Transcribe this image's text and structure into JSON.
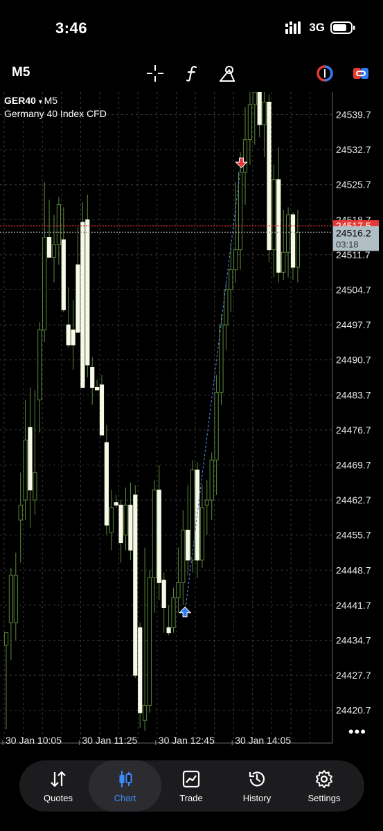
{
  "status_bar": {
    "time": "3:46",
    "network": "3G"
  },
  "toolbar": {
    "timeframe": "M5"
  },
  "chart_header": {
    "symbol": "GER40",
    "symbol_timeframe": "M5",
    "description": "Germany 40 Index CFD"
  },
  "chart_data": {
    "type": "candlestick",
    "symbol": "GER40",
    "timeframe": "M5",
    "y_ticks": [
      24539.7,
      24532.7,
      24525.7,
      24518.7,
      24511.7,
      24504.7,
      24497.7,
      24490.7,
      24483.7,
      24476.7,
      24469.7,
      24462.7,
      24455.7,
      24448.7,
      24441.7,
      24434.7,
      24427.7,
      24420.7
    ],
    "y_tick_labels": [
      "24539.7",
      "24532.7",
      "24525.7",
      "24518.7",
      "24511.7",
      "24504.7",
      "24497.7",
      "24490.7",
      "24483.7",
      "24476.7",
      "24469.7",
      "24462.7",
      "24455.7",
      "24448.7",
      "24441.7",
      "24434.7",
      "24427.7",
      "24420.7"
    ],
    "ylim": [
      24416.6,
      24545.5
    ],
    "x_labels": [
      "30 Jan 10:05",
      "30 Jan 11:25",
      "30 Jan 12:45",
      "30 Jan 14:05"
    ],
    "x_label_indices": [
      0,
      16,
      32,
      48
    ],
    "candles": [
      {
        "o": 24433.7,
        "h": 24436.2,
        "l": 24416.9,
        "c": 24436.2
      },
      {
        "o": 24438.2,
        "h": 24449.2,
        "l": 24430.7,
        "c": 24447.7
      },
      {
        "o": 24438.2,
        "h": 24452.2,
        "l": 24434.7,
        "c": 24447.7
      },
      {
        "o": 24458.7,
        "h": 24468.2,
        "l": 24450.2,
        "c": 24461.7
      },
      {
        "o": 24462.7,
        "h": 24482.7,
        "l": 24458.7,
        "c": 24474.7
      },
      {
        "o": 24477.2,
        "h": 24485.2,
        "l": 24457.2,
        "c": 24464.7
      },
      {
        "o": 24462.7,
        "h": 24484.7,
        "l": 24459.7,
        "c": 24468.2
      },
      {
        "o": 24482.7,
        "h": 24498.2,
        "l": 24476.2,
        "c": 24496.7
      },
      {
        "o": 24496.7,
        "h": 24526.2,
        "l": 24494.2,
        "c": 24515.2
      },
      {
        "o": 24515.2,
        "h": 24522.7,
        "l": 24511.7,
        "c": 24511.2
      },
      {
        "o": 24511.2,
        "h": 24519.7,
        "l": 24506.2,
        "c": 24513.7
      },
      {
        "o": 24513.7,
        "h": 24523.2,
        "l": 24509.7,
        "c": 24521.7
      },
      {
        "o": 24514.7,
        "h": 24521.2,
        "l": 24500.2,
        "c": 24500.7
      },
      {
        "o": 24497.7,
        "h": 24505.2,
        "l": 24493.2,
        "c": 24493.7
      },
      {
        "o": 24496.7,
        "h": 24502.7,
        "l": 24488.7,
        "c": 24493.7
      },
      {
        "o": 24509.7,
        "h": 24517.2,
        "l": 24496.2,
        "c": 24496.2
      },
      {
        "o": 24518.2,
        "h": 24522.2,
        "l": 24485.2,
        "c": 24485.2
      },
      {
        "o": 24518.7,
        "h": 24523.7,
        "l": 24487.2,
        "c": 24489.7
      },
      {
        "o": 24489.2,
        "h": 24491.2,
        "l": 24481.7,
        "c": 24485.2
      },
      {
        "o": 24485.2,
        "h": 24486.7,
        "l": 24484.7,
        "c": 24484.7
      },
      {
        "o": 24485.7,
        "h": 24487.7,
        "l": 24475.7,
        "c": 24475.7
      },
      {
        "o": 24474.2,
        "h": 24477.7,
        "l": 24455.7,
        "c": 24457.7
      },
      {
        "o": 24456.2,
        "h": 24464.7,
        "l": 24452.7,
        "c": 24461.2
      },
      {
        "o": 24462.2,
        "h": 24463.7,
        "l": 24461.2,
        "c": 24461.7
      },
      {
        "o": 24461.7,
        "h": 24462.7,
        "l": 24450.2,
        "c": 24454.2
      },
      {
        "o": 24455.7,
        "h": 24465.2,
        "l": 24452.7,
        "c": 24461.7
      },
      {
        "o": 24461.7,
        "h": 24466.2,
        "l": 24450.7,
        "c": 24452.7
      },
      {
        "o": 24463.7,
        "h": 24465.7,
        "l": 24427.2,
        "c": 24427.7
      },
      {
        "o": 24437.2,
        "h": 24438.2,
        "l": 24417.2,
        "c": 24420.2
      },
      {
        "o": 24418.7,
        "h": 24453.2,
        "l": 24416.6,
        "c": 24421.7
      },
      {
        "o": 24421.7,
        "h": 24448.7,
        "l": 24420.2,
        "c": 24447.2
      },
      {
        "o": 24447.2,
        "h": 24466.7,
        "l": 24440.2,
        "c": 24464.7
      },
      {
        "o": 24464.7,
        "h": 24469.7,
        "l": 24442.7,
        "c": 24446.2
      },
      {
        "o": 24446.7,
        "h": 24448.2,
        "l": 24436.2,
        "c": 24441.2
      },
      {
        "o": 24437.2,
        "h": 24441.7,
        "l": 24435.7,
        "c": 24436.2
      },
      {
        "o": 24437.2,
        "h": 24445.2,
        "l": 24436.2,
        "c": 24443.2
      },
      {
        "o": 24443.2,
        "h": 24453.2,
        "l": 24440.2,
        "c": 24446.2
      },
      {
        "o": 24446.2,
        "h": 24460.7,
        "l": 24441.7,
        "c": 24456.7
      },
      {
        "o": 24456.7,
        "h": 24465.7,
        "l": 24447.7,
        "c": 24450.7
      },
      {
        "o": 24450.7,
        "h": 24470.7,
        "l": 24448.2,
        "c": 24468.7
      },
      {
        "o": 24468.7,
        "h": 24470.2,
        "l": 24447.2,
        "c": 24450.7
      },
      {
        "o": 24450.7,
        "h": 24465.7,
        "l": 24449.2,
        "c": 24461.2
      },
      {
        "o": 24461.7,
        "h": 24466.7,
        "l": 24455.7,
        "c": 24462.7
      },
      {
        "o": 24462.7,
        "h": 24472.2,
        "l": 24458.7,
        "c": 24470.7
      },
      {
        "o": 24470.7,
        "h": 24487.7,
        "l": 24463.7,
        "c": 24484.2
      },
      {
        "o": 24484.2,
        "h": 24499.7,
        "l": 24481.7,
        "c": 24497.7
      },
      {
        "o": 24497.7,
        "h": 24506.2,
        "l": 24492.7,
        "c": 24504.7
      },
      {
        "o": 24504.7,
        "h": 24514.2,
        "l": 24500.2,
        "c": 24508.7
      },
      {
        "o": 24508.7,
        "h": 24526.2,
        "l": 24506.2,
        "c": 24512.7
      },
      {
        "o": 24512.7,
        "h": 24532.2,
        "l": 24508.7,
        "c": 24528.2
      },
      {
        "o": 24528.2,
        "h": 24541.2,
        "l": 24521.7,
        "c": 24534.7
      },
      {
        "o": 24534.7,
        "h": 24545.5,
        "l": 24529.7,
        "c": 24541.7
      },
      {
        "o": 24541.7,
        "h": 24545.5,
        "l": 24533.7,
        "c": 24545.5
      },
      {
        "o": 24545.5,
        "h": 24545.5,
        "l": 24535.2,
        "c": 24537.7
      },
      {
        "o": 24537.7,
        "h": 24545.5,
        "l": 24531.2,
        "c": 24542.2
      },
      {
        "o": 24542.2,
        "h": 24543.7,
        "l": 24510.2,
        "c": 24512.7
      },
      {
        "o": 24512.7,
        "h": 24529.7,
        "l": 24507.2,
        "c": 24526.7
      },
      {
        "o": 24526.7,
        "h": 24533.2,
        "l": 24506.2,
        "c": 24508.2
      },
      {
        "o": 24508.2,
        "h": 24520.7,
        "l": 24506.7,
        "c": 24512.2
      },
      {
        "o": 24512.2,
        "h": 24521.2,
        "l": 24507.2,
        "c": 24519.7
      },
      {
        "o": 24519.7,
        "h": 24520.2,
        "l": 24506.7,
        "c": 24509.2
      },
      {
        "o": 24509.2,
        "h": 24520.7,
        "l": 24506.2,
        "c": 24516.2
      }
    ],
    "ask_price": 24517.5,
    "bid_price_label": "24516.2",
    "bid_price": 24516.2,
    "countdown": "03:18",
    "ask_label": "24517.5",
    "trade_buy": {
      "candle": 37.4,
      "price": 24440.2
    },
    "trade_sell": {
      "candle": 49.2,
      "price": 24530.2
    },
    "colors": {
      "background": "#000000",
      "grid": "#3a3a3a",
      "bull_body": "#000000",
      "bull_outline": "#5b8a3a",
      "bear_body": "#f6f9e6",
      "wick": "#5b8a3a",
      "ask_line": "#e53935",
      "bid_line": "#9e9e9e",
      "buy_marker": "#2f7cf6",
      "sell_marker": "#e53935",
      "trade_line": "#4a7fe0"
    }
  },
  "bottom_nav": {
    "items": [
      {
        "label": "Quotes",
        "icon": "quotes-icon",
        "active": false
      },
      {
        "label": "Chart",
        "icon": "chart-icon",
        "active": true
      },
      {
        "label": "Trade",
        "icon": "trade-icon",
        "active": false
      },
      {
        "label": "History",
        "icon": "history-icon",
        "active": false
      },
      {
        "label": "Settings",
        "icon": "settings-icon",
        "active": false
      }
    ],
    "active_color": "#3d8bff"
  }
}
